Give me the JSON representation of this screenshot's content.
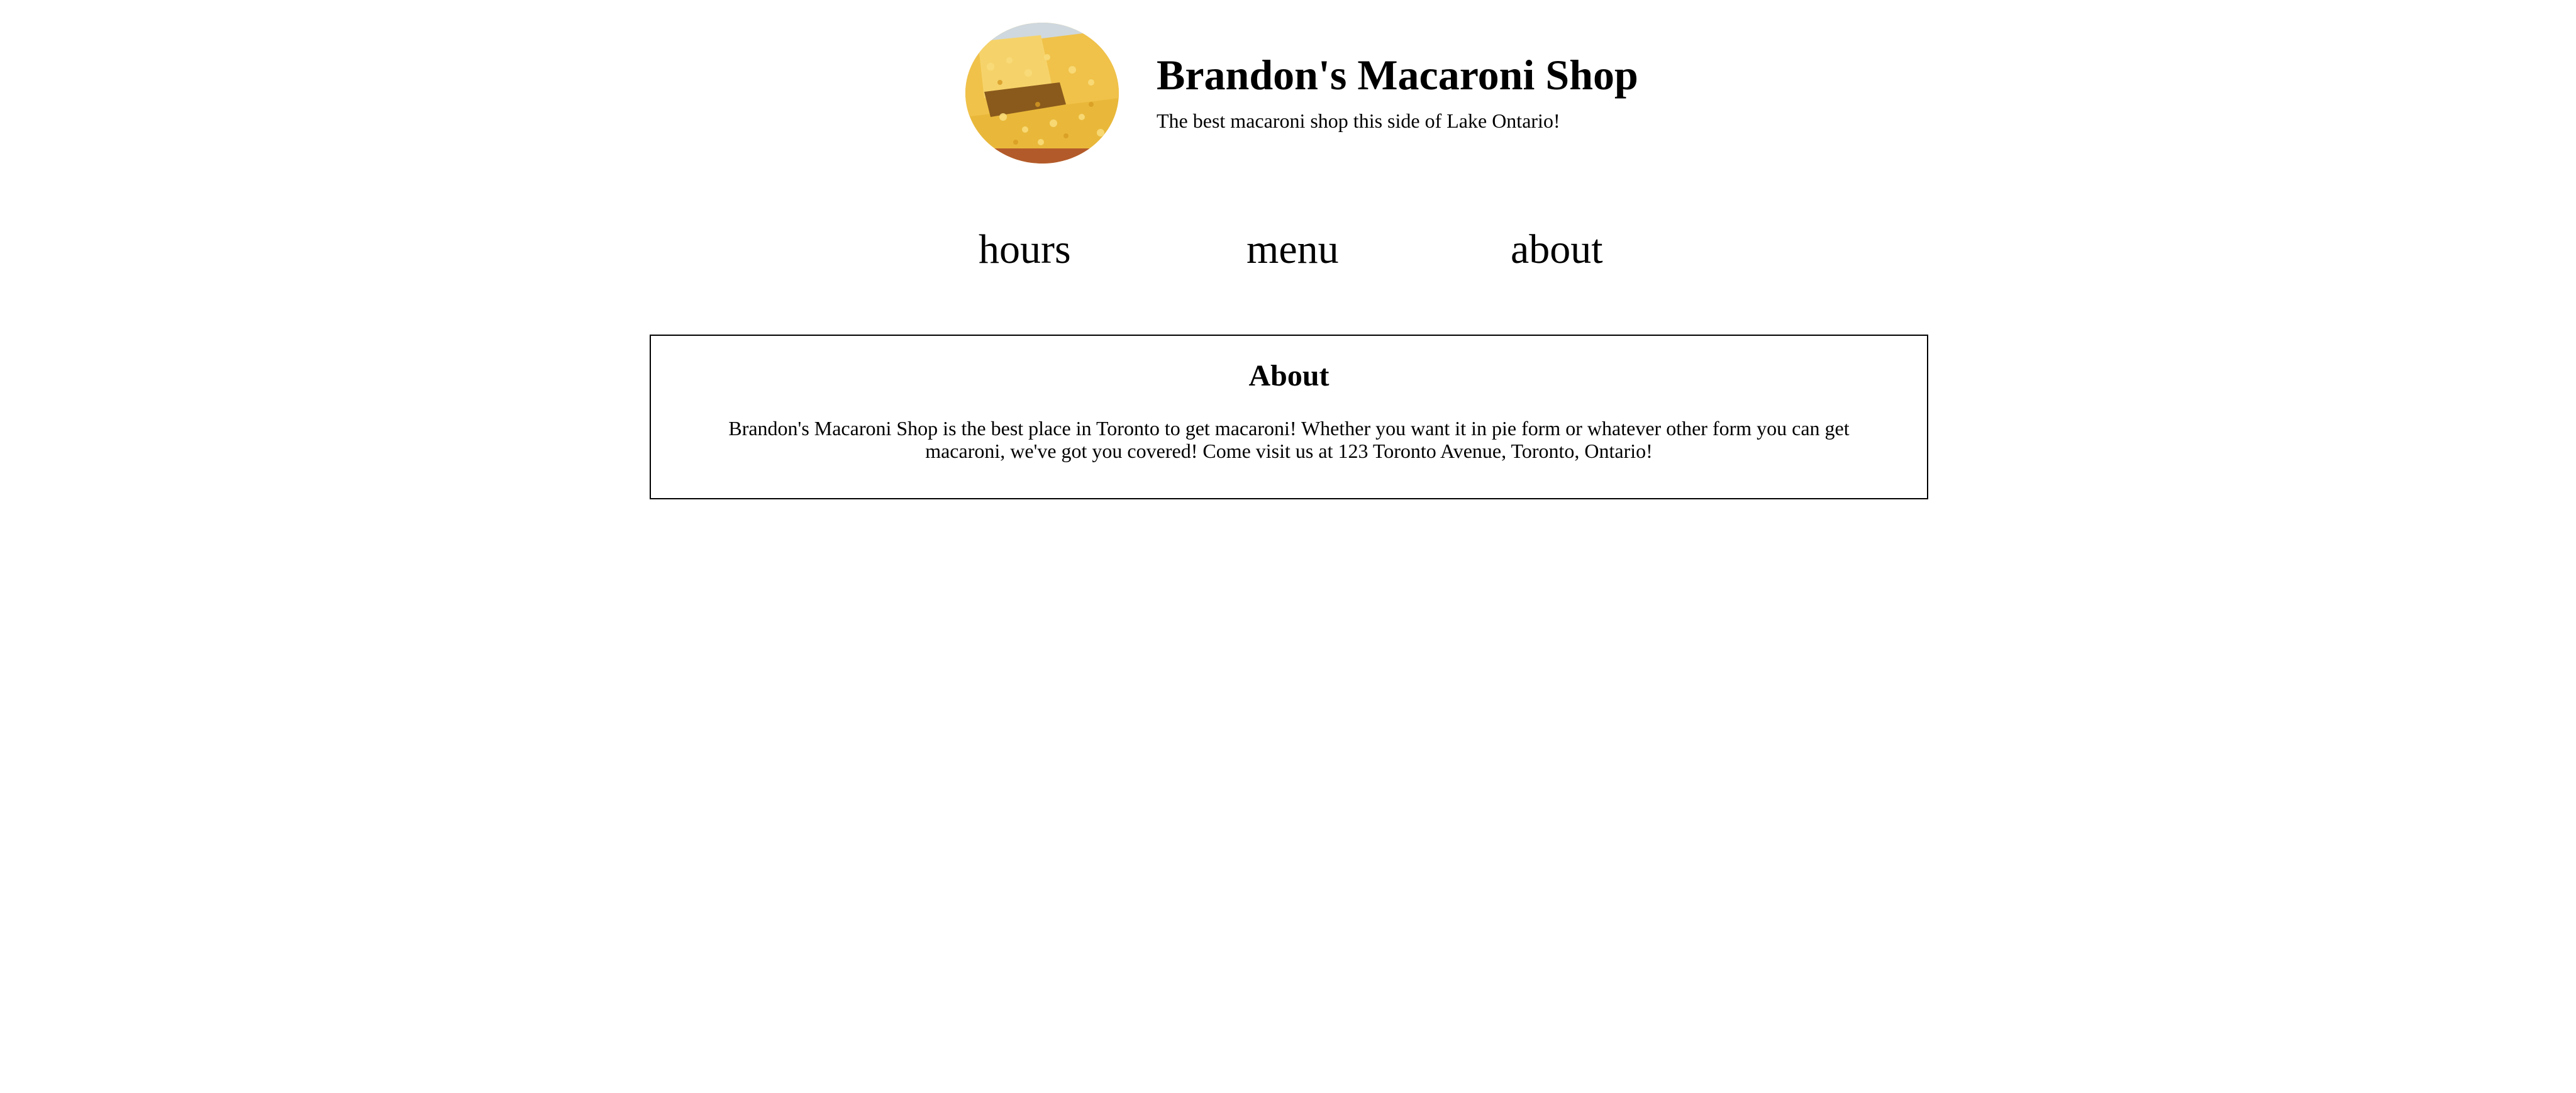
{
  "header": {
    "logo_icon": "macaroni-photo-icon",
    "title": "Brandon's Macaroni Shop",
    "tagline": "The best macaroni shop this side of Lake Ontario!"
  },
  "nav": {
    "items": [
      {
        "label": "hours"
      },
      {
        "label": "menu"
      },
      {
        "label": "about"
      }
    ]
  },
  "about": {
    "heading": "About",
    "body": "Brandon's Macaroni Shop is the best place in Toronto to get macaroni! Whether you want it in pie form or whatever other form you can get macaroni, we've got you covered! Come visit us at 123 Toronto Avenue, Toronto, Ontario!"
  },
  "colors": {
    "text": "#000000",
    "background": "#ffffff",
    "border": "#000000",
    "macaroni_yellow": "#e9b83a"
  }
}
